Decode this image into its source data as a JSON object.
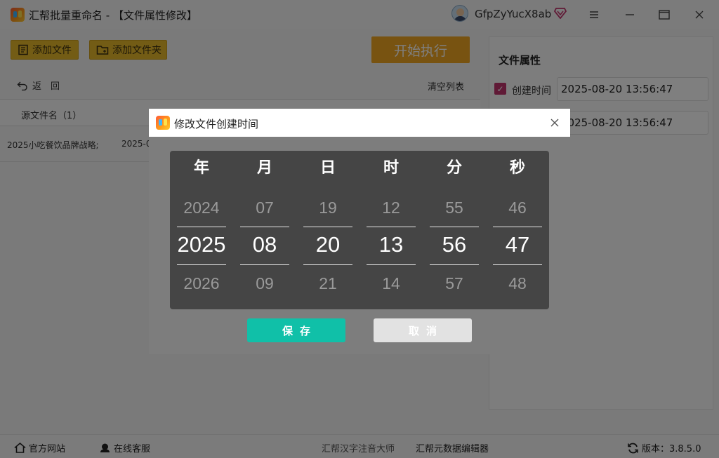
{
  "window": {
    "title": "汇帮批量重命名 - 【文件属性修改】",
    "username": "GfpZyYucX8ab",
    "icons": {
      "app": "app-logo-icon",
      "vip": "vip-diamond-icon",
      "menu": "menu-icon",
      "minimize": "minimize-icon",
      "maximize": "maximize-icon",
      "close": "close-icon"
    }
  },
  "toolbar": {
    "add_file": "添加文件",
    "add_folder": "添加文件夹",
    "start": "开始执行",
    "back": "返　回",
    "clear_list": "清空列表"
  },
  "file_list": {
    "columns": [
      "源文件名（1）"
    ],
    "rows": [
      {
        "name": "2025小吃餐饮品牌战略;",
        "date": "2025-0"
      }
    ]
  },
  "properties": {
    "title": "文件属性",
    "created_label": "创建时间",
    "created_checked": true,
    "created_value": "2025-08-20 13:56:47",
    "modified_value": "2025-08-20 13:56:47"
  },
  "dialog": {
    "title": "修改文件创建时间",
    "columns": [
      {
        "label": "年",
        "prev": "2024",
        "current": "2025",
        "next": "2026"
      },
      {
        "label": "月",
        "prev": "07",
        "current": "08",
        "next": "09"
      },
      {
        "label": "日",
        "prev": "19",
        "current": "20",
        "next": "21"
      },
      {
        "label": "时",
        "prev": "12",
        "current": "13",
        "next": "14"
      },
      {
        "label": "分",
        "prev": "55",
        "current": "56",
        "next": "57"
      },
      {
        "label": "秒",
        "prev": "46",
        "current": "47",
        "next": "48"
      }
    ],
    "save": "保存",
    "cancel": "取消"
  },
  "footer": {
    "official_site": "官方网站",
    "online_service": "在线客服",
    "hanzi_tool": "汇帮汉字注音大师",
    "metadata_editor": "汇帮元数据编辑器",
    "version": "版本：3.8.5.0"
  },
  "colors": {
    "accent_yellow": "#e7b92a",
    "start_orange": "#f0a623",
    "save_teal": "#10c0a8",
    "checkbox_pink": "#c1346d"
  }
}
